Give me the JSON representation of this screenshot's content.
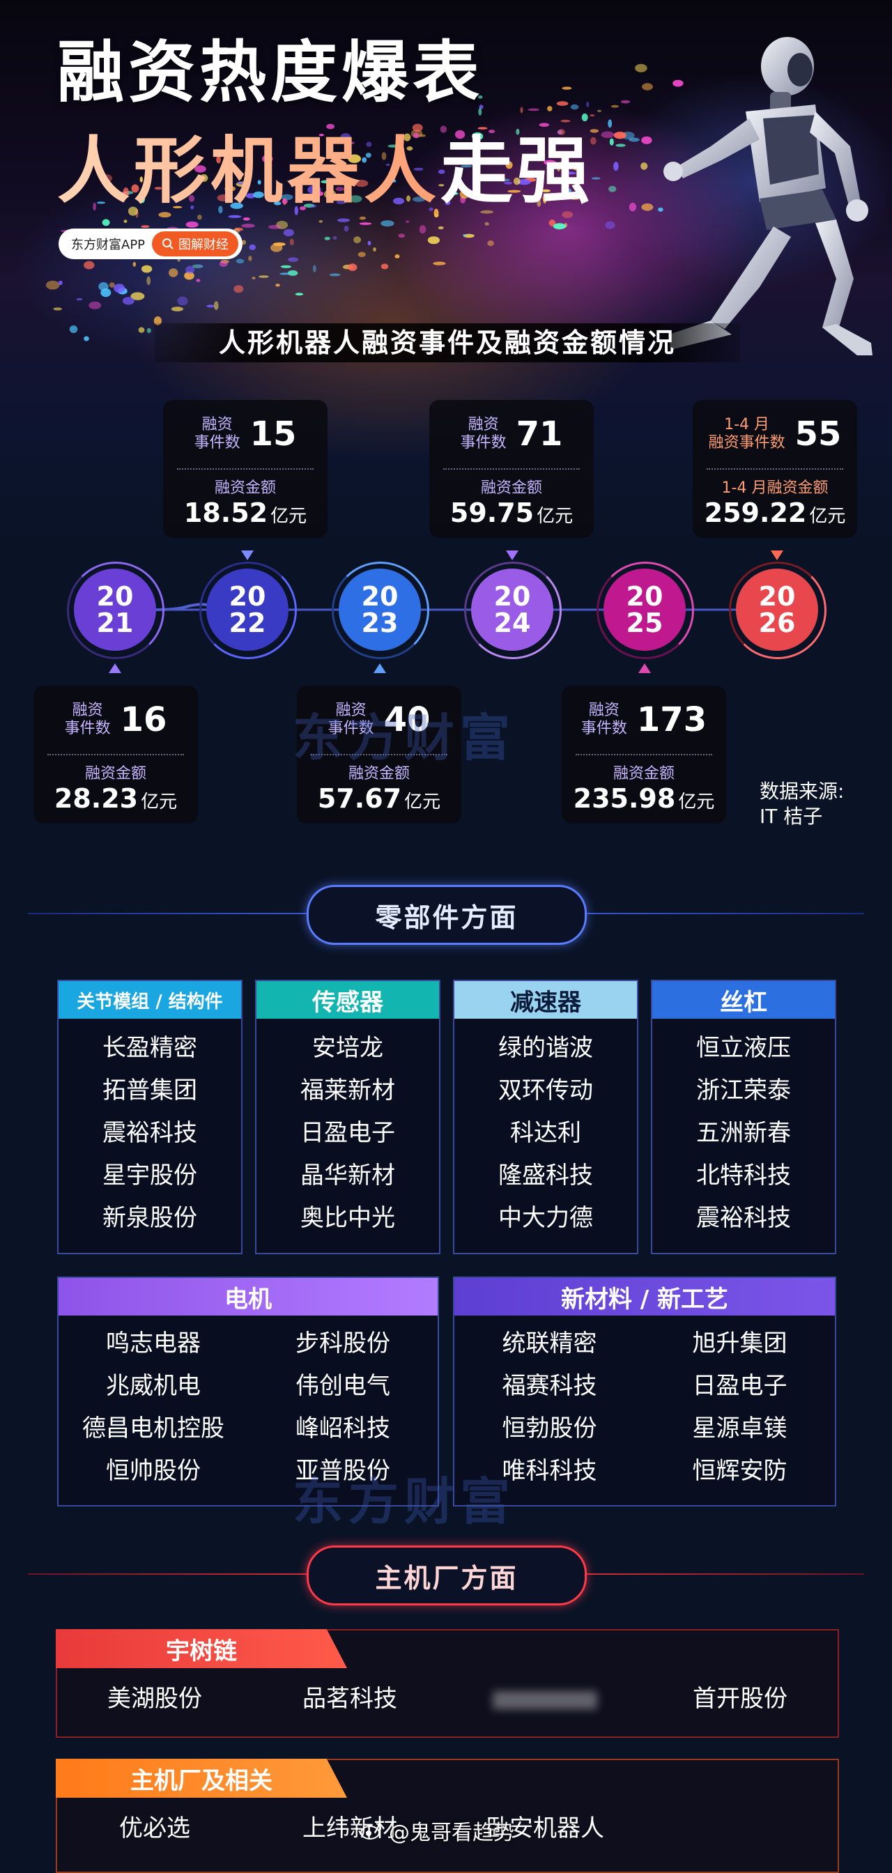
{
  "hero": {
    "title_line1": "融资热度爆表",
    "title_line2_a": "人形机器人",
    "title_line2_b": "走强",
    "badge_app": "东方财富APP",
    "badge_tag": "图解财经",
    "subtitle": "人形机器人融资事件及融资金额情况"
  },
  "stats": [
    {
      "year_top": "20",
      "year_bottom": "21",
      "events_label_1": "融资",
      "events_label_2": "事件数",
      "events": "16",
      "amount_label": "融资金额",
      "amount": "28.23",
      "unit": "亿元"
    },
    {
      "year_top": "20",
      "year_bottom": "22",
      "events_label_1": "融资",
      "events_label_2": "事件数",
      "events": "15",
      "amount_label": "融资金额",
      "amount": "18.52",
      "unit": "亿元"
    },
    {
      "year_top": "20",
      "year_bottom": "23",
      "events_label_1": "融资",
      "events_label_2": "事件数",
      "events": "40",
      "amount_label": "融资金额",
      "amount": "57.67",
      "unit": "亿元"
    },
    {
      "year_top": "20",
      "year_bottom": "24",
      "events_label_1": "融资",
      "events_label_2": "事件数",
      "events": "71",
      "amount_label": "融资金额",
      "amount": "59.75",
      "unit": "亿元"
    },
    {
      "year_top": "20",
      "year_bottom": "25",
      "events_label_1": "融资",
      "events_label_2": "事件数",
      "events": "173",
      "amount_label": "融资金额",
      "amount": "235.98",
      "unit": "亿元"
    },
    {
      "year_top": "20",
      "year_bottom": "26",
      "events_label_1": "1-4 月",
      "events_label_2": "融资事件数",
      "events": "55",
      "amount_label": "1-4 月融资金额",
      "amount": "259.22",
      "unit": "亿元"
    }
  ],
  "source": {
    "line1": "数据来源:",
    "line2": "IT 桔子"
  },
  "watermark": "东方财富",
  "components": {
    "title": "零部件方面",
    "columns": [
      {
        "header": "关节模组 / 结构件",
        "items": [
          "长盈精密",
          "拓普集团",
          "震裕科技",
          "星宇股份",
          "新泉股份"
        ]
      },
      {
        "header": "传感器",
        "items": [
          "安培龙",
          "福莱新材",
          "日盈电子",
          "晶华新材",
          "奥比中光"
        ]
      },
      {
        "header": "减速器",
        "items": [
          "绿的谐波",
          "双环传动",
          "科达利",
          "隆盛科技",
          "中大力德"
        ]
      },
      {
        "header": "丝杠",
        "items": [
          "恒立液压",
          "浙江荣泰",
          "五洲新春",
          "北特科技",
          "震裕科技"
        ]
      }
    ],
    "motor": {
      "header": "电机",
      "items": [
        "鸣志电器",
        "步科股份",
        "兆威机电",
        "伟创电气",
        "德昌电机控股",
        "峰岹科技",
        "恒帅股份",
        "亚普股份"
      ]
    },
    "material": {
      "header": "新材料 / 新工艺",
      "items": [
        "统联精密",
        "旭升集团",
        "福赛科技",
        "日盈电子",
        "恒勃股份",
        "星源卓镁",
        "唯科科技",
        "恒辉安防"
      ]
    },
    "colors": {
      "c1": "#1aa6e0",
      "c2": "#13b5b0",
      "c3": "#9ad3f0",
      "c4": "#2b6fe0",
      "motor": "#8e54e9",
      "material": "#5d3fd3"
    }
  },
  "oem": {
    "title": "主机厂方面",
    "groups": [
      {
        "header": "宇树链",
        "items": [
          "美湖股份",
          "品茗科技",
          "",
          "首开股份"
        ]
      },
      {
        "header": "主机厂及相关",
        "items": [
          "优必选",
          "上纬新材",
          "卧安机器人",
          ""
        ]
      }
    ]
  },
  "footer": {
    "weibo": "@鬼哥看趋势"
  }
}
